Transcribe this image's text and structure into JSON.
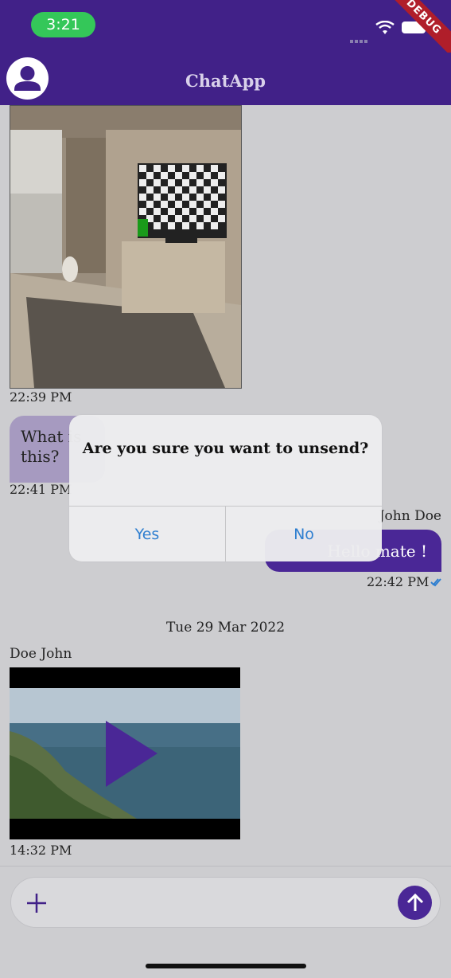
{
  "status_bar": {
    "time": "3:21"
  },
  "debug_banner": "DEBUG",
  "app_bar": {
    "title": "ChatApp"
  },
  "messages": {
    "photo_time": "22:39 PM",
    "incoming_text": "What is this?",
    "incoming_time": "22:41 PM",
    "outgoing_sender": "John Doe",
    "outgoing_text": "Hello mate !",
    "outgoing_time": "22:42 PM",
    "date_separator": "Tue 29 Mar 2022",
    "video_sender": "Doe John",
    "video_time": "14:32 PM"
  },
  "dialog": {
    "title": "Are you sure you want to unsend?",
    "yes_label": "Yes",
    "no_label": "No"
  },
  "colors": {
    "primary": "#412188",
    "accent_bubble": "#4a2796",
    "incoming_bubble": "#a69ac0",
    "dialog_button_text": "#2f7fd0"
  },
  "icons": {
    "avatar": "person-icon",
    "attach": "plus-icon",
    "send": "arrow-up-icon",
    "read_receipt": "double-check-icon",
    "play": "play-icon"
  }
}
